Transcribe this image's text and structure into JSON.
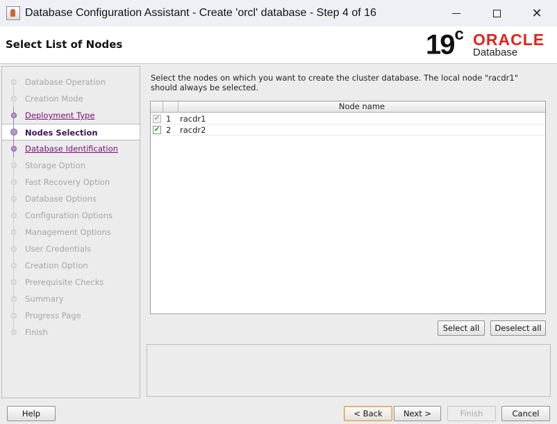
{
  "window": {
    "title": "Database Configuration Assistant - Create 'orcl' database - Step 4 of 16",
    "controls": {
      "minimize_icon": "minimize-icon",
      "maximize_icon": "maximize-icon",
      "close_glyph": "✕"
    }
  },
  "header": {
    "page_title": "Select List of Nodes",
    "logo": {
      "version": "19",
      "version_sup": "c",
      "brand": "ORACLE",
      "product": "Database",
      "brand_color": "#e2231a"
    }
  },
  "sidebar": {
    "steps": [
      {
        "label": "Database Operation",
        "state": "disabled"
      },
      {
        "label": "Creation Mode",
        "state": "disabled"
      },
      {
        "label": "Deployment Type",
        "state": "link"
      },
      {
        "label": "Nodes Selection",
        "state": "current"
      },
      {
        "label": "Database Identification",
        "state": "link"
      },
      {
        "label": "Storage Option",
        "state": "disabled"
      },
      {
        "label": "Fast Recovery Option",
        "state": "disabled"
      },
      {
        "label": "Database Options",
        "state": "disabled"
      },
      {
        "label": "Configuration Options",
        "state": "disabled"
      },
      {
        "label": "Management Options",
        "state": "disabled"
      },
      {
        "label": "User Credentials",
        "state": "disabled"
      },
      {
        "label": "Creation Option",
        "state": "disabled"
      },
      {
        "label": "Prerequisite Checks",
        "state": "disabled"
      },
      {
        "label": "Summary",
        "state": "disabled"
      },
      {
        "label": "Progress Page",
        "state": "disabled"
      },
      {
        "label": "Finish",
        "state": "disabled"
      }
    ]
  },
  "main": {
    "intro": "Select the nodes on which you want to create the cluster database. The local node \"racdr1\" should always be selected.",
    "table": {
      "column_header": "Node name",
      "rows": [
        {
          "num": "1",
          "name": "racdr1",
          "checked": true,
          "enabled": false
        },
        {
          "num": "2",
          "name": "racdr2",
          "checked": true,
          "enabled": true
        }
      ]
    },
    "select_all_label": "Select all",
    "deselect_all_label": "Deselect all"
  },
  "footer": {
    "help_label": "Help",
    "back_label": "< Back",
    "next_label": "Next >",
    "finish_label": "Finish",
    "cancel_label": "Cancel"
  },
  "check_glyph": "✔"
}
